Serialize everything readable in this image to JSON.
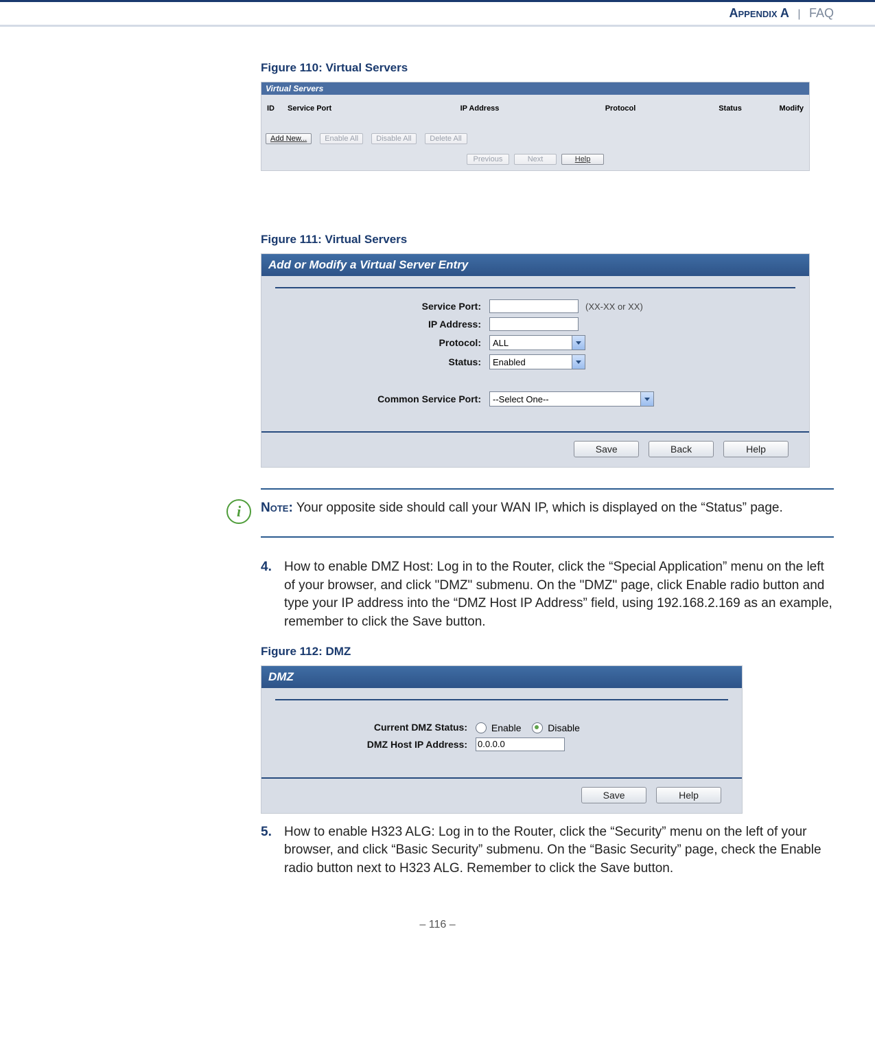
{
  "header": {
    "appendix": "Appendix A",
    "separator": "|",
    "faq": "FAQ"
  },
  "figure110": {
    "title": "Figure 110:  Virtual Servers",
    "panel_title": "Virtual Servers",
    "columns": {
      "id": "ID",
      "service_port": "Service Port",
      "ip_address": "IP Address",
      "protocol": "Protocol",
      "status": "Status",
      "modify": "Modify"
    },
    "buttons": {
      "add_new": "Add New...",
      "enable_all": "Enable All",
      "disable_all": "Disable All",
      "delete_all": "Delete All",
      "previous": "Previous",
      "next": "Next",
      "help": "Help"
    }
  },
  "figure111": {
    "title": "Figure 111:  Virtual Servers",
    "panel_title": "Add or Modify a Virtual Server Entry",
    "labels": {
      "service_port": "Service Port:",
      "ip_address": "IP Address:",
      "protocol": "Protocol:",
      "status": "Status:",
      "common_service_port": "Common Service Port:"
    },
    "values": {
      "service_port": "",
      "ip_address": "",
      "protocol": "ALL",
      "status": "Enabled",
      "common_service_port": "--Select One--"
    },
    "hint": "(XX-XX or XX)",
    "buttons": {
      "save": "Save",
      "back": "Back",
      "help": "Help"
    }
  },
  "note": {
    "title": "Note:",
    "text": " Your opposite side should call your WAN IP, which is displayed on the “Status” page."
  },
  "step4": {
    "num": "4.",
    "text": "How to enable DMZ Host: Log in to the Router, click the “Special Application” menu on the left of your browser, and click \"DMZ\" submenu. On the \"DMZ\" page, click Enable radio button and type your IP address into the “DMZ Host IP Address” field, using 192.168.2.169 as an example, remember to click the Save button."
  },
  "figure112": {
    "title": "Figure 112:  DMZ",
    "panel_title": "DMZ",
    "labels": {
      "current_status": "Current DMZ Status:",
      "host_ip": "DMZ Host IP Address:"
    },
    "radios": {
      "enable": "Enable",
      "disable": "Disable"
    },
    "values": {
      "host_ip": "0.0.0.0",
      "selected": "disable"
    },
    "buttons": {
      "save": "Save",
      "help": "Help"
    }
  },
  "step5": {
    "num": "5.",
    "text": "How to enable H323 ALG: Log in to the Router, click the “Security” menu on the left of your browser, and click “Basic Security” submenu. On the “Basic Security” page, check the Enable radio button next to H323 ALG. Remember to click the Save button."
  },
  "footer": {
    "page": "–  116  –"
  }
}
